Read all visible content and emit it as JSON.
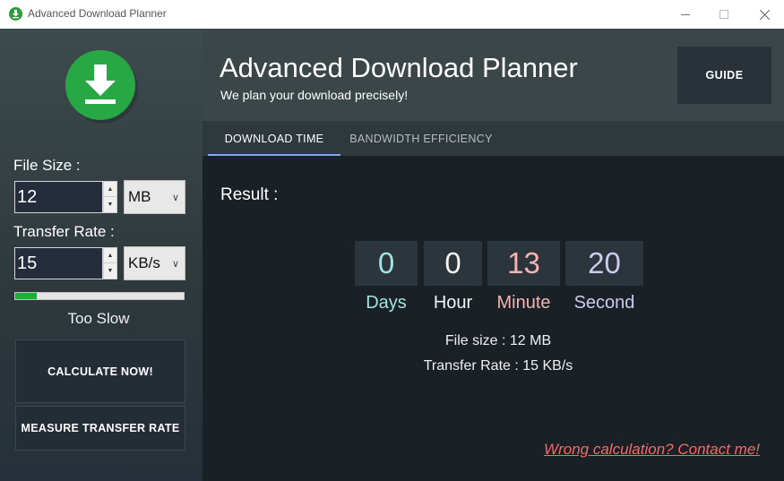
{
  "window": {
    "title": "Advanced Download Planner",
    "icon": "download-app-icon"
  },
  "sidebar": {
    "logo_icon": "download-icon",
    "file_size_label": "File Size :",
    "file_size_value": "12",
    "file_size_unit": "MB",
    "transfer_rate_label": "Transfer Rate :",
    "transfer_rate_value": "15",
    "transfer_rate_unit": "KB/s",
    "speed_level": 0.13,
    "speed_text": "Too Slow",
    "calculate_button": "CALCULATE NOW!",
    "measure_button": "MEASURE TRANSFER RATE"
  },
  "header": {
    "title": "Advanced Download Planner",
    "subtitle": "We plan your download precisely!",
    "guide_button": "GUIDE"
  },
  "tabs": [
    {
      "label": "DOWNLOAD TIME",
      "active": true
    },
    {
      "label": "BANDWIDTH EFFICIENCY",
      "active": false
    }
  ],
  "result": {
    "label": "Result :",
    "days": "0",
    "hours": "0",
    "minutes": "13",
    "seconds": "20",
    "days_label": "Days",
    "hours_label": "Hour",
    "minutes_label": "Minute",
    "seconds_label": "Second",
    "file_size_summary": "File size : 12 MB",
    "transfer_rate_summary": "Transfer Rate : 15 KB/s",
    "contact_link": "Wrong calculation? Contact me!"
  },
  "colors": {
    "accent_green": "#27a844",
    "tab_underline": "#7aa8ff",
    "days_color": "#9fe3e2",
    "minutes_color": "#f4b4b2",
    "seconds_color": "#cfc9ef",
    "link_color": "#ee6d66"
  }
}
